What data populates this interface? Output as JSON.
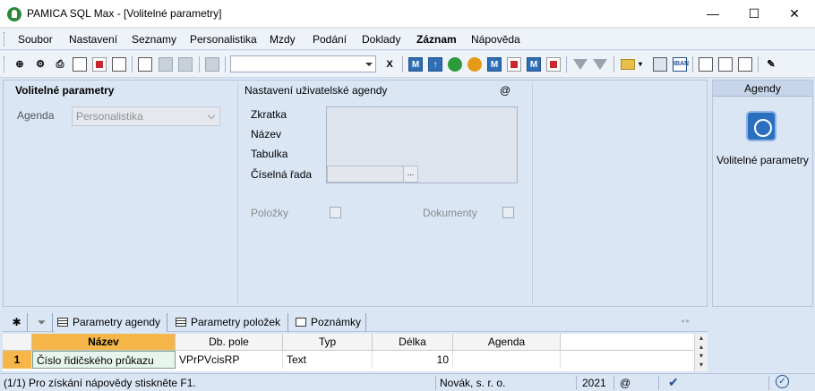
{
  "window": {
    "title": "PAMICA SQL Max - [Volitelné parametry]",
    "min": "—",
    "max": "☐",
    "close": "✕"
  },
  "menu": [
    "Soubor",
    "Nastavení",
    "Seznamy",
    "Personalistika",
    "Mzdy",
    "Podání",
    "Doklady",
    "Záznam",
    "Nápověda"
  ],
  "toolbar": {
    "combo_value": ""
  },
  "form": {
    "title": "Volitelné parametry",
    "agenda_label": "Agenda",
    "agenda_value": "Personalistika",
    "user_agenda_title": "Nastavení uživatelské agendy",
    "at_sign": "@",
    "zkratka_label": "Zkratka",
    "nazev_label": "Název",
    "tabulka_label": "Tabulka",
    "ciselna_rada_label": "Číselná řada",
    "ciselna_rada_btn": "...",
    "polozky_label": "Položky",
    "dokumenty_label": "Dokumenty"
  },
  "side": {
    "header": "Agendy",
    "item_label": "Volitelné parametry"
  },
  "tabs": {
    "star": "✱",
    "filter": "⏷",
    "parametry_agendy": "Parametry agendy",
    "parametry_polozek": "Parametry položek",
    "poznamky": "Poznámky",
    "arrows": "◂ ▸"
  },
  "grid": {
    "columns": [
      "Název",
      "Db. pole",
      "Typ",
      "Délka",
      "Agenda"
    ],
    "rows": [
      {
        "num": "1",
        "nazev": "Číslo řidičského průkazu",
        "db_pole": "VPrPVcisRP",
        "typ": "Text",
        "delka": "10",
        "agenda": ""
      }
    ]
  },
  "status": {
    "help": "(1/1) Pro získání nápovědy stiskněte F1.",
    "company": "Novák, s. r. o.",
    "year": "2021",
    "at": "@"
  }
}
